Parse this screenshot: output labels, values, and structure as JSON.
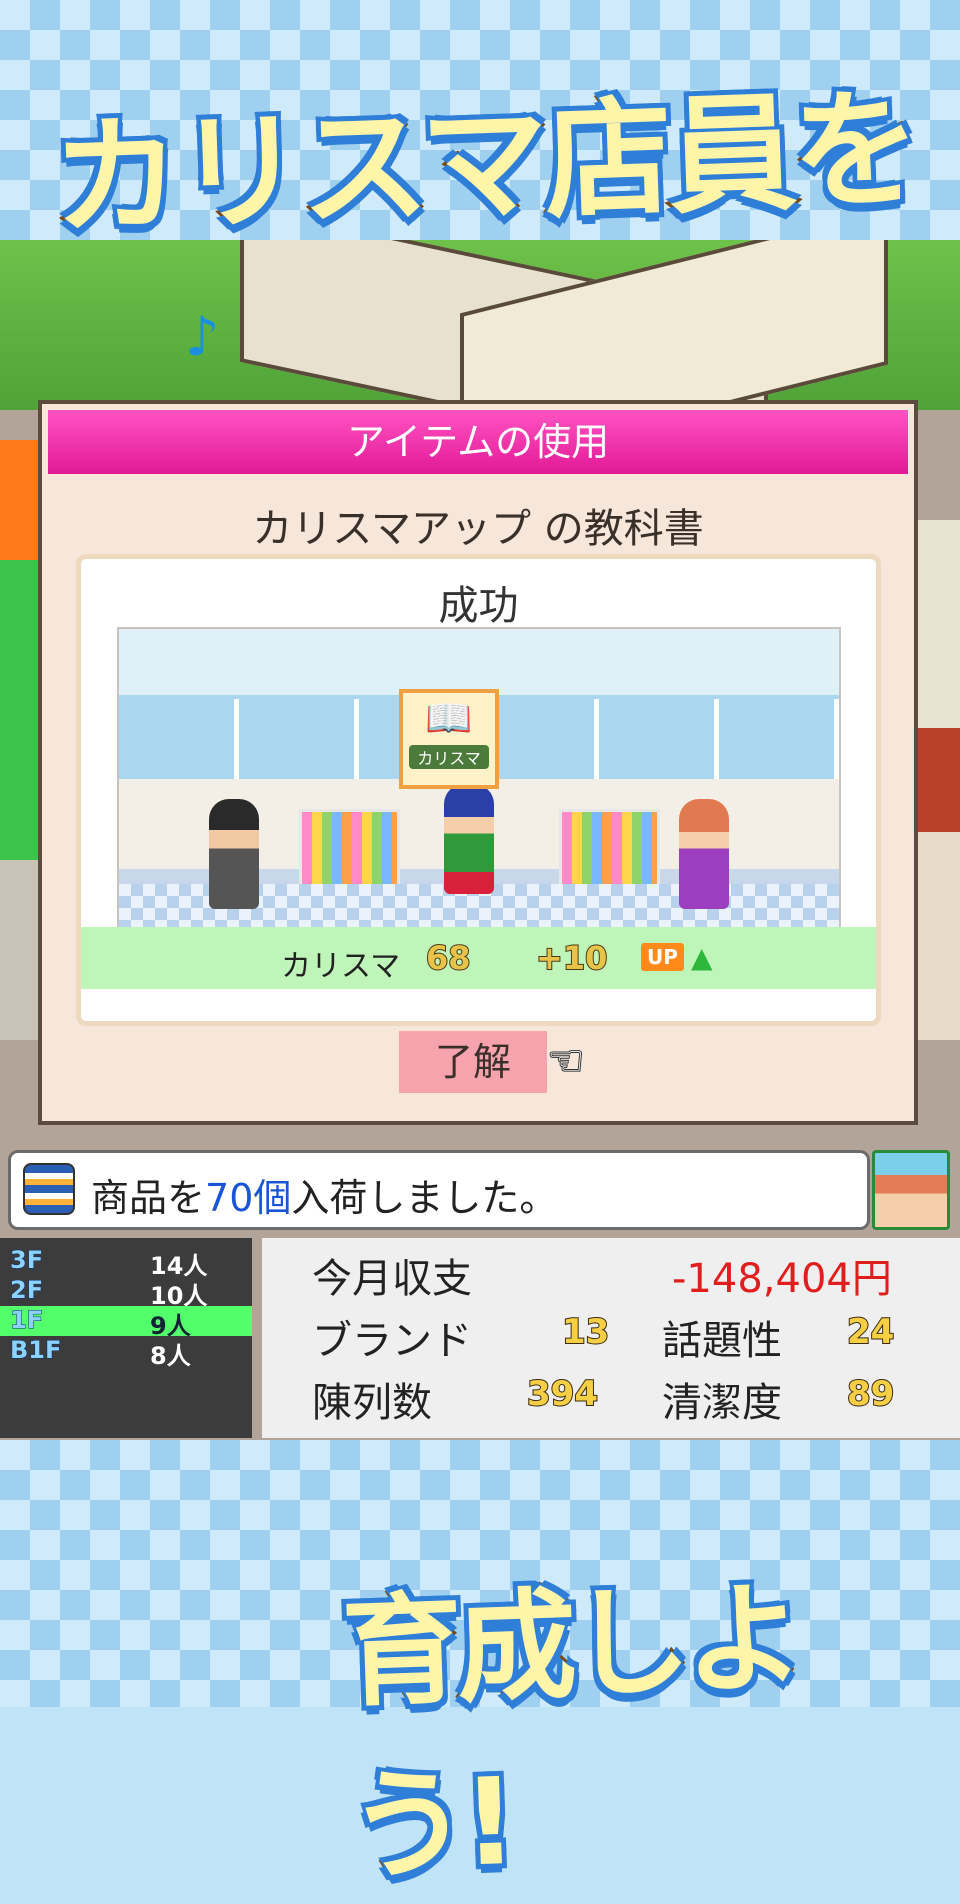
{
  "headline_top": "カリスマ店員を",
  "headline_bottom": "育成しよう!",
  "dialog": {
    "header": "アイテムの使用",
    "subtitle": "カリスマアップ の教科書",
    "result_title": "成功",
    "item_caption": "カリスマ",
    "stat_label": "カリスマ",
    "stat_value": "68",
    "stat_increase": "+10",
    "stat_up": "UP",
    "ok_button": "了解"
  },
  "message": {
    "prefix": "商品を",
    "count": "70個",
    "suffix": "入荷しました。"
  },
  "floors": [
    {
      "floor": "3F",
      "count": "14人"
    },
    {
      "floor": "2F",
      "count": "10人"
    },
    {
      "floor": "1F",
      "count": "9人"
    },
    {
      "floor": "B1F",
      "count": "8人"
    }
  ],
  "stats": {
    "monthly_label": "今月収支",
    "monthly_value": "-148,404円",
    "brand_label": "ブランド",
    "brand_value": "13",
    "topic_label": "話題性",
    "topic_value": "24",
    "display_label": "陳列数",
    "display_value": "394",
    "clean_label": "清潔度",
    "clean_value": "89"
  },
  "colors": {
    "header": "#e21a96",
    "ok_button": "#f7a3ad",
    "highlight": "#1a55d8",
    "negative_money": "#e01e1e"
  },
  "icons": [
    "music-note-icon",
    "book-icon",
    "pointing-hand-icon",
    "shirt-icon",
    "up-arrow-icon"
  ]
}
